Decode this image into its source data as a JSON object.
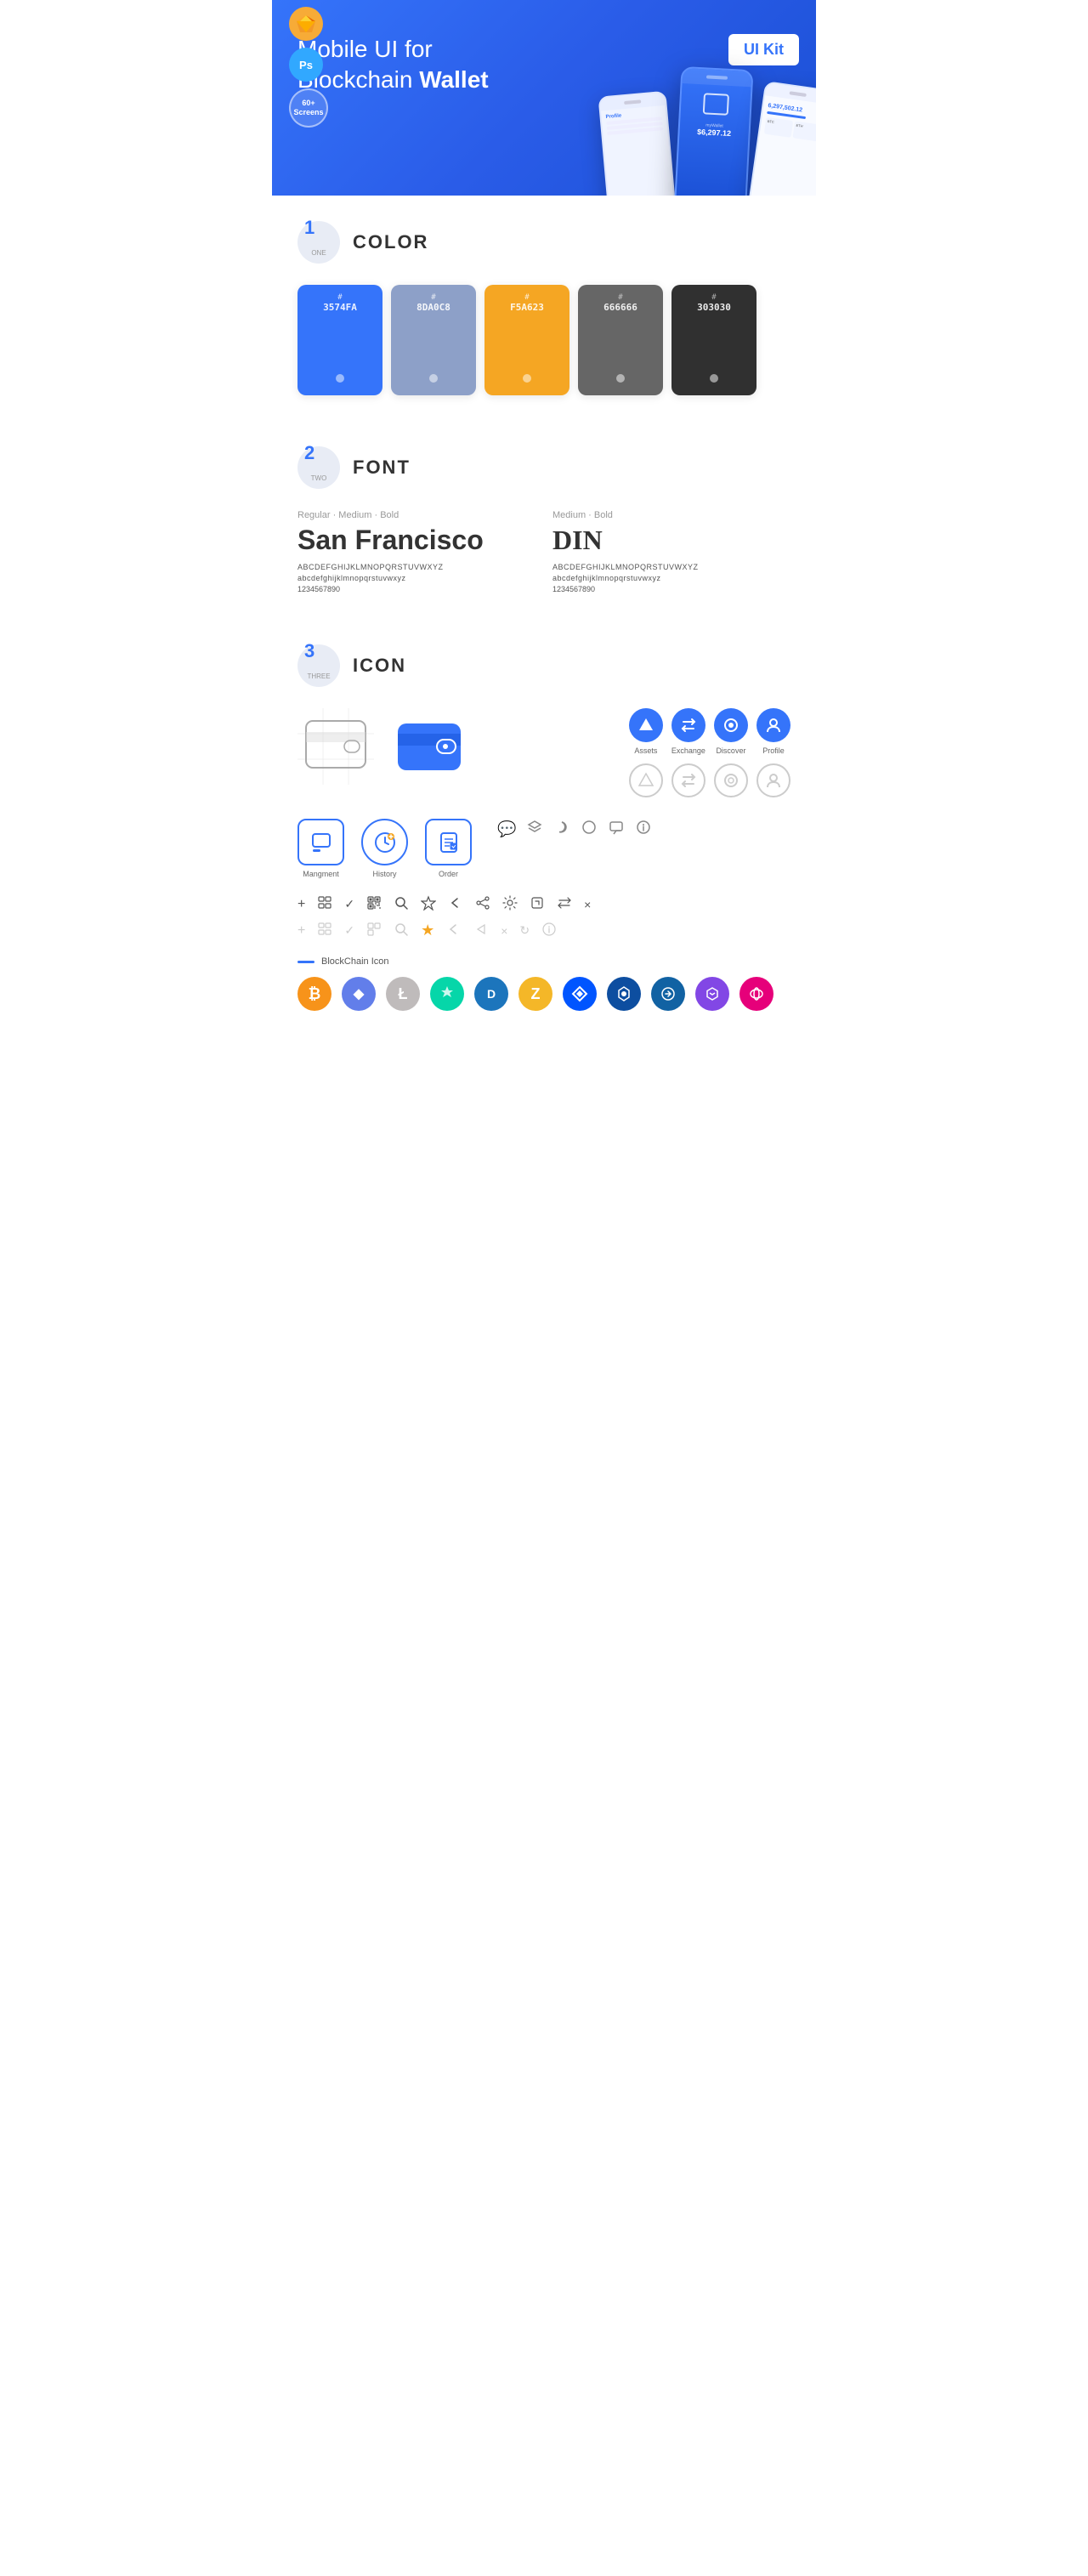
{
  "hero": {
    "title": "Mobile UI for Blockchain ",
    "title_bold": "Wallet",
    "badge": "UI Kit",
    "badges": [
      {
        "label": "Sk",
        "type": "sketch",
        "bg": "#F7AB37"
      },
      {
        "label": "Ps",
        "type": "ps",
        "bg": "#31A8FF"
      },
      {
        "label": "60+\nScreens",
        "type": "screens"
      }
    ]
  },
  "section1": {
    "number": "1",
    "number_text": "ONE",
    "title": "COLOR",
    "colors": [
      {
        "hex": "#3574FA",
        "label": "#",
        "value": "3574FA"
      },
      {
        "hex": "#8DA0C8",
        "label": "#",
        "value": "8DA0C8"
      },
      {
        "hex": "#F5A623",
        "label": "#",
        "value": "F5A623"
      },
      {
        "hex": "#666666",
        "label": "#",
        "value": "666666"
      },
      {
        "hex": "#303030",
        "label": "#",
        "value": "303030"
      }
    ]
  },
  "section2": {
    "number": "2",
    "number_text": "TWO",
    "title": "FONT",
    "font1": {
      "weights": "Regular · Medium · Bold",
      "name": "San Francisco",
      "upper": "ABCDEFGHIJKLMNOPQRSTUVWXYZ",
      "lower": "abcdefghijklmnopqrstuvwxyz",
      "numbers": "1234567890"
    },
    "font2": {
      "weights": "Medium · Bold",
      "name": "DIN",
      "upper": "ABCDEFGHIJKLMNOPQRSTUVWXYZ",
      "lower": "abcdefghijklmnopqrstuvwxyz",
      "numbers": "1234567890"
    }
  },
  "section3": {
    "number": "3",
    "number_text": "THREE",
    "title": "ICON",
    "tab_icons": [
      {
        "label": "Assets",
        "color": "#3574FA"
      },
      {
        "label": "Exchange",
        "color": "#3574FA"
      },
      {
        "label": "Discover",
        "color": "#3574FA"
      },
      {
        "label": "Profile",
        "color": "#3574FA"
      }
    ],
    "app_icons": [
      {
        "label": "Mangment"
      },
      {
        "label": "History"
      },
      {
        "label": "Order"
      }
    ],
    "util_icons": [
      "+",
      "⊞",
      "✓",
      "⊞",
      "🔍",
      "☆",
      "<",
      "⟨",
      "⚙",
      "⊡",
      "⇄",
      "×"
    ],
    "blockchain_label": "BlockChain Icon",
    "crypto_coins": [
      {
        "name": "Bitcoin",
        "symbol": "₿",
        "bg": "#F7931A",
        "color": "#fff"
      },
      {
        "name": "Ethereum",
        "symbol": "Ξ",
        "bg": "#627EEA",
        "color": "#fff"
      },
      {
        "name": "Litecoin",
        "symbol": "Ł",
        "bg": "#BFBBBB",
        "color": "#fff"
      },
      {
        "name": "Steem",
        "symbol": "S",
        "bg": "#06D6A9",
        "color": "#fff"
      },
      {
        "name": "Dash",
        "symbol": "Đ",
        "bg": "#1C75BC",
        "color": "#fff"
      },
      {
        "name": "Zcash",
        "symbol": "Z",
        "bg": "#F4B728",
        "color": "#fff"
      },
      {
        "name": "Waves",
        "symbol": "W",
        "bg": "#0055FF",
        "color": "#fff"
      },
      {
        "name": "Lisk",
        "symbol": "L",
        "bg": "#0D4EA0",
        "color": "#fff"
      },
      {
        "name": "Ardor",
        "symbol": "A",
        "bg": "#1162A3",
        "color": "#fff"
      },
      {
        "name": "Matic",
        "symbol": "M",
        "bg": "#8247E5",
        "color": "#fff"
      },
      {
        "name": "Polkadot",
        "symbol": "◆",
        "bg": "#E6007A",
        "color": "#fff"
      }
    ]
  }
}
